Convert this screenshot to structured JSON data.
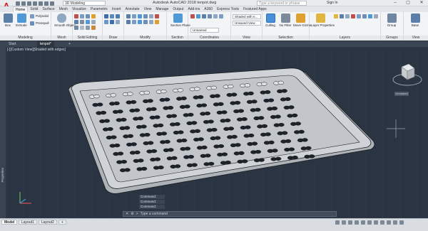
{
  "colors": {
    "accent": "#0078d7",
    "brand": "#d21f26",
    "viewport_bg": "#2b3442",
    "model_fill": "#c9cdd2",
    "model_edge": "#1c1f24"
  },
  "titlebar": {
    "workspace": "3D Modeling",
    "title": "Autodesk AutoCAD 2018   tenpot.dwg",
    "search_placeholder": "Type a keyword or phrase",
    "user": "Sign In",
    "icons": [
      "minimize-icon",
      "restore-icon",
      "close-icon"
    ]
  },
  "tabs": [
    "Home",
    "Solid",
    "Surface",
    "Mesh",
    "Visualize",
    "Parametric",
    "Insert",
    "Annotate",
    "View",
    "Manage",
    "Output",
    "Add-ins",
    "A360",
    "Express Tools",
    "Featured Apps"
  ],
  "ribbon": {
    "box_label": "Box",
    "extrude_label": "Extrude",
    "polysolid_label": "Polysolid",
    "presspull_label": "Presspull",
    "smooth_object_label": "Smooth Object",
    "section_plane_label": "Section Plane",
    "visual_style": "Shaded with e...",
    "unsaved_view": "Unsaved View",
    "unnamed": "Unnamed",
    "culling_label": "Culling",
    "no_filter_label": "No Filter",
    "move_gizmo_label": "Move Gizmo",
    "layer_properties_label": "Layer Properties",
    "group_label": "Group",
    "base_label": "Base",
    "panels": {
      "modeling": "Modeling",
      "mesh": "Mesh",
      "solid_editing": "Solid Editing",
      "draw": "Draw",
      "modify": "Modify",
      "section": "Section",
      "coordinates": "Coordinates",
      "view": "View",
      "selection": "Selection",
      "layers": "Layers",
      "groups": "Groups",
      "view2": "View"
    }
  },
  "filetabs": {
    "start": "Start",
    "file": "tenpot*"
  },
  "viewport": {
    "label": "[-][Custom View][Shaded with edges]"
  },
  "properties_label": "Properties",
  "command_history": [
    "Command:",
    "Command:",
    "Command:"
  ],
  "command_placeholder": "Type a command",
  "layout_tabs": [
    "Model",
    "Layout1",
    "Layout2"
  ],
  "viewcube": {
    "label": "Unnamed"
  }
}
